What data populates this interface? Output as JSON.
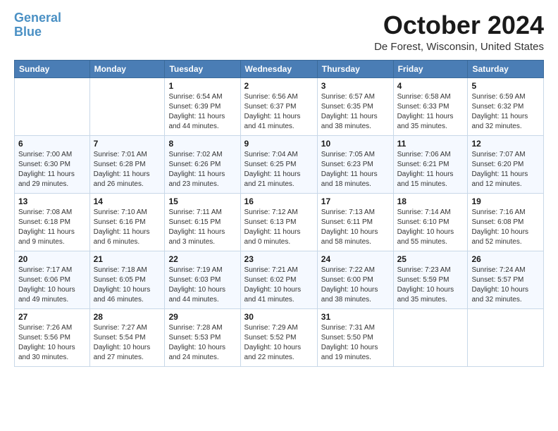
{
  "header": {
    "logo_line1": "General",
    "logo_line2": "Blue",
    "month": "October 2024",
    "location": "De Forest, Wisconsin, United States"
  },
  "days_of_week": [
    "Sunday",
    "Monday",
    "Tuesday",
    "Wednesday",
    "Thursday",
    "Friday",
    "Saturday"
  ],
  "weeks": [
    [
      {
        "day": "",
        "info": ""
      },
      {
        "day": "",
        "info": ""
      },
      {
        "day": "1",
        "info": "Sunrise: 6:54 AM\nSunset: 6:39 PM\nDaylight: 11 hours and 44 minutes."
      },
      {
        "day": "2",
        "info": "Sunrise: 6:56 AM\nSunset: 6:37 PM\nDaylight: 11 hours and 41 minutes."
      },
      {
        "day": "3",
        "info": "Sunrise: 6:57 AM\nSunset: 6:35 PM\nDaylight: 11 hours and 38 minutes."
      },
      {
        "day": "4",
        "info": "Sunrise: 6:58 AM\nSunset: 6:33 PM\nDaylight: 11 hours and 35 minutes."
      },
      {
        "day": "5",
        "info": "Sunrise: 6:59 AM\nSunset: 6:32 PM\nDaylight: 11 hours and 32 minutes."
      }
    ],
    [
      {
        "day": "6",
        "info": "Sunrise: 7:00 AM\nSunset: 6:30 PM\nDaylight: 11 hours and 29 minutes."
      },
      {
        "day": "7",
        "info": "Sunrise: 7:01 AM\nSunset: 6:28 PM\nDaylight: 11 hours and 26 minutes."
      },
      {
        "day": "8",
        "info": "Sunrise: 7:02 AM\nSunset: 6:26 PM\nDaylight: 11 hours and 23 minutes."
      },
      {
        "day": "9",
        "info": "Sunrise: 7:04 AM\nSunset: 6:25 PM\nDaylight: 11 hours and 21 minutes."
      },
      {
        "day": "10",
        "info": "Sunrise: 7:05 AM\nSunset: 6:23 PM\nDaylight: 11 hours and 18 minutes."
      },
      {
        "day": "11",
        "info": "Sunrise: 7:06 AM\nSunset: 6:21 PM\nDaylight: 11 hours and 15 minutes."
      },
      {
        "day": "12",
        "info": "Sunrise: 7:07 AM\nSunset: 6:20 PM\nDaylight: 11 hours and 12 minutes."
      }
    ],
    [
      {
        "day": "13",
        "info": "Sunrise: 7:08 AM\nSunset: 6:18 PM\nDaylight: 11 hours and 9 minutes."
      },
      {
        "day": "14",
        "info": "Sunrise: 7:10 AM\nSunset: 6:16 PM\nDaylight: 11 hours and 6 minutes."
      },
      {
        "day": "15",
        "info": "Sunrise: 7:11 AM\nSunset: 6:15 PM\nDaylight: 11 hours and 3 minutes."
      },
      {
        "day": "16",
        "info": "Sunrise: 7:12 AM\nSunset: 6:13 PM\nDaylight: 11 hours and 0 minutes."
      },
      {
        "day": "17",
        "info": "Sunrise: 7:13 AM\nSunset: 6:11 PM\nDaylight: 10 hours and 58 minutes."
      },
      {
        "day": "18",
        "info": "Sunrise: 7:14 AM\nSunset: 6:10 PM\nDaylight: 10 hours and 55 minutes."
      },
      {
        "day": "19",
        "info": "Sunrise: 7:16 AM\nSunset: 6:08 PM\nDaylight: 10 hours and 52 minutes."
      }
    ],
    [
      {
        "day": "20",
        "info": "Sunrise: 7:17 AM\nSunset: 6:06 PM\nDaylight: 10 hours and 49 minutes."
      },
      {
        "day": "21",
        "info": "Sunrise: 7:18 AM\nSunset: 6:05 PM\nDaylight: 10 hours and 46 minutes."
      },
      {
        "day": "22",
        "info": "Sunrise: 7:19 AM\nSunset: 6:03 PM\nDaylight: 10 hours and 44 minutes."
      },
      {
        "day": "23",
        "info": "Sunrise: 7:21 AM\nSunset: 6:02 PM\nDaylight: 10 hours and 41 minutes."
      },
      {
        "day": "24",
        "info": "Sunrise: 7:22 AM\nSunset: 6:00 PM\nDaylight: 10 hours and 38 minutes."
      },
      {
        "day": "25",
        "info": "Sunrise: 7:23 AM\nSunset: 5:59 PM\nDaylight: 10 hours and 35 minutes."
      },
      {
        "day": "26",
        "info": "Sunrise: 7:24 AM\nSunset: 5:57 PM\nDaylight: 10 hours and 32 minutes."
      }
    ],
    [
      {
        "day": "27",
        "info": "Sunrise: 7:26 AM\nSunset: 5:56 PM\nDaylight: 10 hours and 30 minutes."
      },
      {
        "day": "28",
        "info": "Sunrise: 7:27 AM\nSunset: 5:54 PM\nDaylight: 10 hours and 27 minutes."
      },
      {
        "day": "29",
        "info": "Sunrise: 7:28 AM\nSunset: 5:53 PM\nDaylight: 10 hours and 24 minutes."
      },
      {
        "day": "30",
        "info": "Sunrise: 7:29 AM\nSunset: 5:52 PM\nDaylight: 10 hours and 22 minutes."
      },
      {
        "day": "31",
        "info": "Sunrise: 7:31 AM\nSunset: 5:50 PM\nDaylight: 10 hours and 19 minutes."
      },
      {
        "day": "",
        "info": ""
      },
      {
        "day": "",
        "info": ""
      }
    ]
  ]
}
